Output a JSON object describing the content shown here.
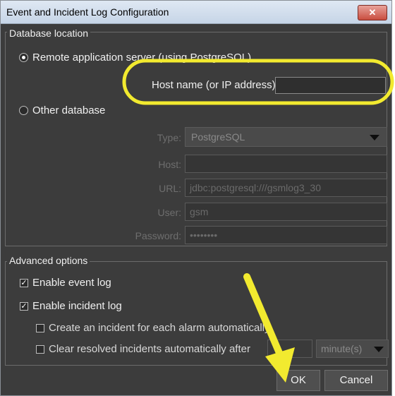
{
  "window": {
    "title": "Event and Incident Log Configuration",
    "close_glyph": "✕"
  },
  "database_location": {
    "legend": "Database location",
    "remote_label": "Remote application server (using PostgreSQL)",
    "host_label": "Host name (or IP address):",
    "host_value": "",
    "other_label": "Other database",
    "type_label": "Type:",
    "type_value": "PostgreSQL",
    "host_field_label": "Host:",
    "host_field_value": "",
    "url_label": "URL:",
    "url_value": "jdbc:postgresql:///gsmlog3_30",
    "user_label": "User:",
    "user_value": "gsm",
    "password_label": "Password:",
    "password_value": "••••••••"
  },
  "advanced_options": {
    "legend": "Advanced options",
    "enable_event_log": "Enable event log",
    "enable_incident_log": "Enable incident log",
    "create_incident": "Create an incident for each alarm automatically",
    "clear_resolved": "Clear resolved incidents automatically after",
    "clear_value": "",
    "unit_value": "minute(s)"
  },
  "buttons": {
    "ok": "OK",
    "cancel": "Cancel"
  },
  "annotations": {
    "highlight_color": "#f2ea2f",
    "arrow_color": "#f2ea2f"
  }
}
